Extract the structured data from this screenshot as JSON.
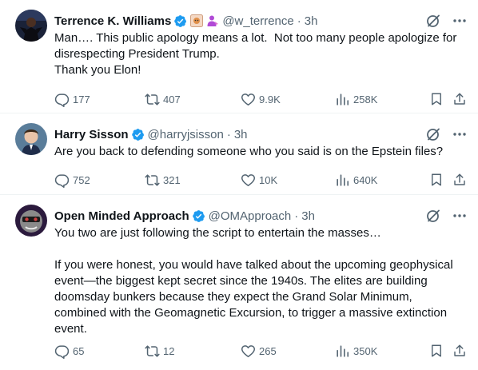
{
  "tweets": [
    {
      "name": "Terrence K. Williams",
      "handle": "@w_terrence",
      "time": "3h",
      "separator": "·",
      "text": "Man…. This public apology means a lot.  Not too many people apologize for disrespecting President Trump.\nThank you Elon!",
      "replies": "177",
      "reposts": "407",
      "likes": "9.9K",
      "views": "258K"
    },
    {
      "name": "Harry Sisson",
      "handle": "@harryjsisson",
      "time": "3h",
      "separator": "·",
      "text": "Are you back to defending someone who you said is on the Epstein files?",
      "replies": "752",
      "reposts": "321",
      "likes": "10K",
      "views": "640K"
    },
    {
      "name": "Open Minded Approach",
      "handle": "@OMApproach",
      "time": "3h",
      "separator": "·",
      "text": "You two are just following the script to entertain the masses…\n\nIf you were honest, you would have talked about the upcoming geophysical event—the biggest kept secret since the 1940s. The elites are building doomsday bunkers because they expect the Grand Solar Minimum, combined with the Geomagnetic Excursion, to trigger a massive extinction event.",
      "replies": "65",
      "reposts": "12",
      "likes": "265",
      "views": "350K"
    }
  ],
  "colors": {
    "verified": "#1d9bf0",
    "secondary_text": "#536471",
    "primary_text": "#0f1419",
    "divider": "#eff3f4"
  },
  "icons": {
    "verified": "verified-badge-icon",
    "grok": "grok-icon",
    "more": "more-icon",
    "reply": "reply-icon",
    "repost": "repost-icon",
    "like": "like-icon",
    "views": "views-icon",
    "bookmark": "bookmark-icon",
    "share": "share-icon"
  }
}
